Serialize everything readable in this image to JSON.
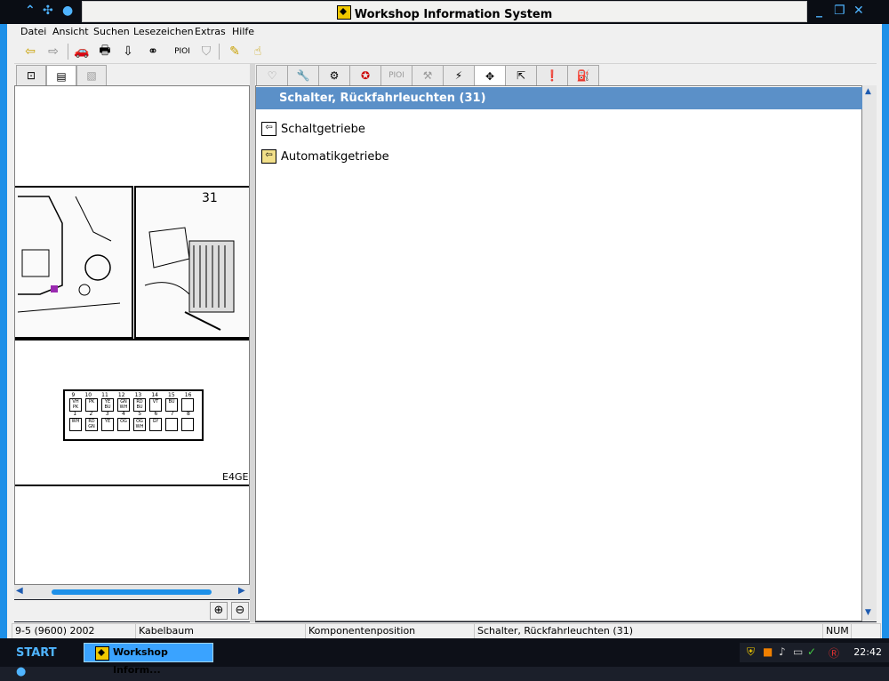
{
  "window": {
    "title": "Workshop Information System"
  },
  "menu": [
    "Datei",
    "Ansicht",
    "Suchen",
    "Lesezeichen",
    "Extras",
    "Hilfe"
  ],
  "toolbar": {
    "pioi_label": "PIOI"
  },
  "tabs_right": {
    "pioi_label": "PIOI"
  },
  "diagram": {
    "component_number": "31",
    "code": "E4GE",
    "pin_numbers_top": [
      "9",
      "10",
      "11",
      "12",
      "13",
      "14",
      "15",
      "16"
    ],
    "pin_numbers_bottom": [
      "1",
      "2",
      "3",
      "4",
      "5",
      "6",
      "7",
      "8"
    ],
    "pins_top": [
      "VH PK",
      "PK",
      "YE BU",
      "GN WH",
      "RD BU",
      "VT",
      "BU",
      ""
    ],
    "pins_bottom": [
      "WH",
      "RD GN",
      "YE",
      "OG",
      "OG WH",
      "GY",
      "",
      ""
    ]
  },
  "content": {
    "header": "Schalter, Rückfahrleuchten (31)",
    "links": [
      "Schaltgetriebe",
      "Automatikgetriebe"
    ]
  },
  "status": {
    "model": "9-5 (9600) 2002",
    "section": "Kabelbaum",
    "view": "Komponentenposition",
    "item": "Schalter, Rückfahrleuchten (31)",
    "num": "NUM"
  },
  "taskbar": {
    "start": "START",
    "task": "Workshop Inform...",
    "clock": "22:42"
  }
}
